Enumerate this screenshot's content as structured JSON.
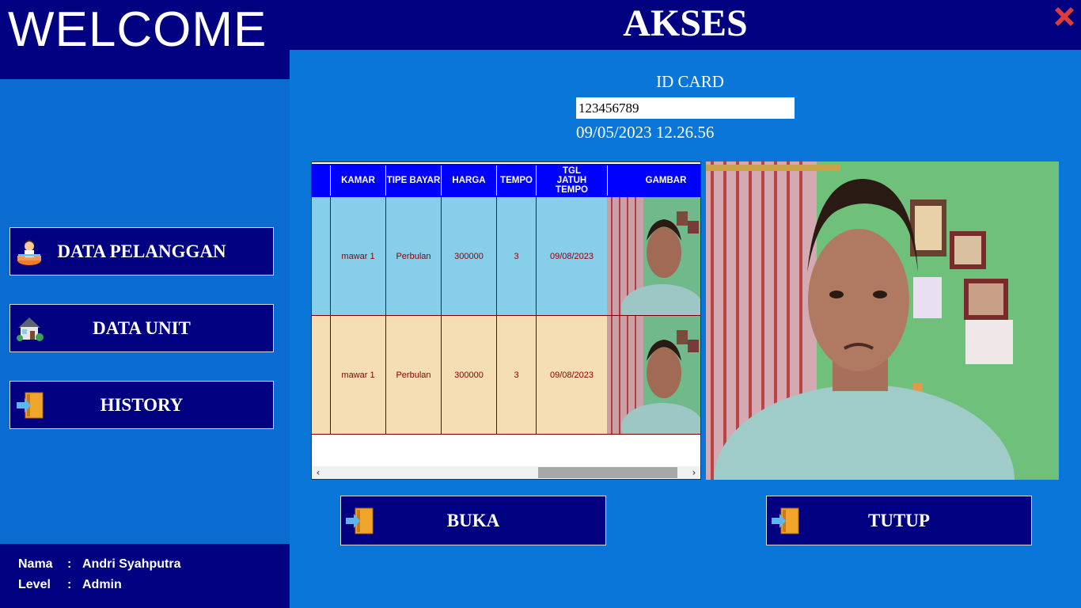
{
  "sidebar": {
    "welcome": "WELCOME",
    "menu": [
      {
        "label": "DATA PELANGGAN",
        "icon": "customer-icon"
      },
      {
        "label": "DATA UNIT",
        "icon": "house-icon"
      },
      {
        "label": "HISTORY",
        "icon": "door-exit-icon"
      }
    ],
    "user": {
      "name_label": "Nama",
      "name_value": "Andri Syahputra",
      "level_label": "Level",
      "level_value": "Admin",
      "separator": ":"
    }
  },
  "header": {
    "title": "AKSES",
    "close_icon": "close-x-icon",
    "close_color": "#e03b3b"
  },
  "idcard": {
    "label": "ID CARD",
    "value": "123456789",
    "datetime": "09/05/2023 12.26.56"
  },
  "grid": {
    "columns": [
      "KAMAR",
      "TIPE BAYAR",
      "HARGA",
      "TEMPO",
      "TGL JATUH TEMPO",
      "GAMBAR"
    ],
    "header_color": "#0000ff",
    "rows": [
      {
        "kamar": "mawar 1",
        "tipe_bayar": "Perbulan",
        "harga": "300000",
        "tempo": "3",
        "tgl_jatuh_tempo": "09/08/2023",
        "color": "#87ceeb"
      },
      {
        "kamar": "mawar 1",
        "tipe_bayar": "Perbulan",
        "harga": "300000",
        "tempo": "3",
        "tgl_jatuh_tempo": "09/08/2023",
        "color": "#f5deb3"
      }
    ]
  },
  "actions": {
    "open_label": "BUKA",
    "close_label": "TUTUP",
    "icon": "door-exit-icon"
  }
}
